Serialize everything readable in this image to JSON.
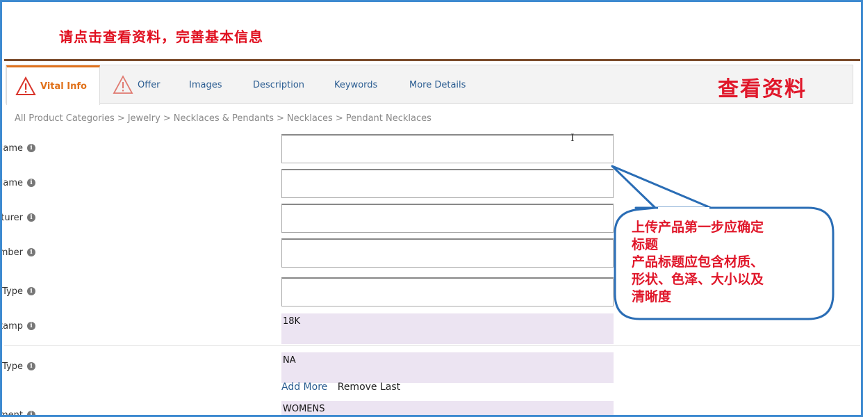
{
  "banner_text": "请点击查看资料，完善基本信息",
  "tabs": [
    {
      "label": "Vital Info",
      "active": true,
      "warning": true
    },
    {
      "label": "Offer",
      "active": false,
      "warning": true
    },
    {
      "label": "Images",
      "active": false,
      "warning": false
    },
    {
      "label": "Description",
      "active": false,
      "warning": false
    },
    {
      "label": "Keywords",
      "active": false,
      "warning": false
    },
    {
      "label": "More Details",
      "active": false,
      "warning": false
    }
  ],
  "view_annotation": "查看资料",
  "breadcrumb": [
    "All Product Categories",
    "Jewelry",
    "Necklaces & Pendants",
    "Necklaces",
    "Pendant Necklaces"
  ],
  "breadcrumb_separator": ">",
  "fields": {
    "product_name": {
      "label": "Product Name",
      "value": ""
    },
    "brand_name": {
      "label": "Brand Name",
      "value": ""
    },
    "manufacturer": {
      "label": "Manufacturer",
      "value": ""
    },
    "model_number": {
      "label": "Model Number",
      "value": ""
    },
    "metal_type": {
      "label": "Metal Type",
      "value": ""
    },
    "metal_stamp": {
      "label": "Metal Stamp",
      "value": "18K"
    },
    "gem_type": {
      "label": "Gem Type",
      "value": "NA"
    },
    "department": {
      "label": "Department",
      "value": "WOMENS"
    }
  },
  "required_marker": "*",
  "info_glyph": "i",
  "gem_links": {
    "add": "Add More",
    "remove": "Remove Last"
  },
  "callout": {
    "line1": "上传产品第一步应确定",
    "line2": "标题",
    "line3": "产品标题应包含材质、",
    "line4": "形状、色泽、大小以及",
    "line5": "清晰度"
  },
  "colors": {
    "frame": "#3d8ad0",
    "accent_orange": "#e0711a",
    "annotation_red": "#e0172a",
    "link_blue": "#2a5c91",
    "readonly_bg": "#ece4f2",
    "callout_border": "#2a6db5"
  }
}
